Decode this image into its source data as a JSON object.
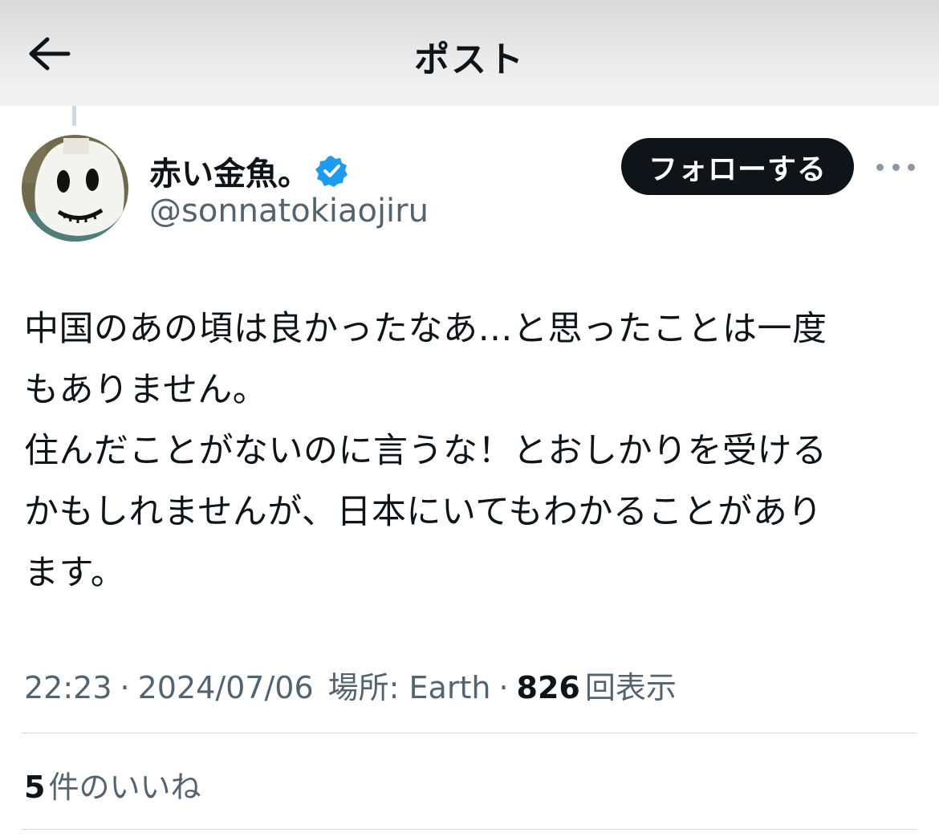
{
  "header": {
    "title": "ポスト",
    "back_icon": "arrow-left-icon"
  },
  "post": {
    "author": {
      "display_name": "赤い金魚。",
      "handle": "@sonnatokiaojiru",
      "verified": true,
      "verified_color": "#1d9bf0"
    },
    "follow_label": "フォローする",
    "more_icon": "more-dots-icon",
    "text_lines": [
      "中国のあの頃は良かったなあ…と思ったことは一度",
      "もありません。",
      "住んだことがないのに言うな！とおしかりを受ける",
      "かもしれませんが、日本にいてもわかることがあり",
      "ます。"
    ],
    "time": "22:23",
    "date": "2024/07/06",
    "location_label": "場所: Earth",
    "views_count": "826",
    "views_label": "回表示",
    "likes_count": "5",
    "likes_label": "件のいいね"
  }
}
